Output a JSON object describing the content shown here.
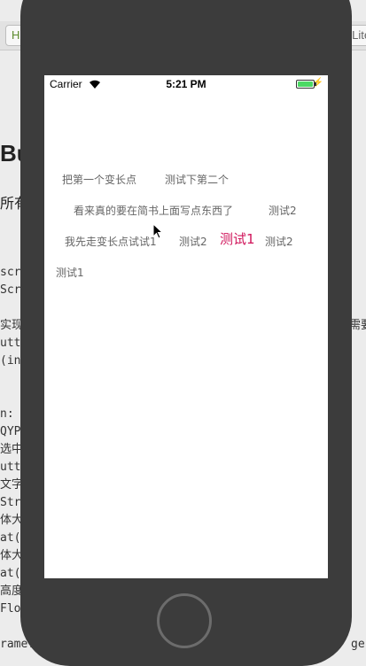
{
  "backdrop": {
    "tab_label": "H",
    "top_right_text": "QLite",
    "heading_big": "Bu",
    "heading_sub": "所有",
    "code_lines": [
      "screen",
      "Scre",
      "",
      "实现类",
      "utto",
      "(in",
      "",
      "",
      "n: (",
      "QYP",
      "选中",
      "utt",
      "文字数",
      "Str",
      "体大小",
      "at(",
      "体大小",
      "at(",
      "高度",
      "Flo",
      "rame:"
    ],
    "right_fragment": "需要",
    "bottom_right_fragment": "ger:"
  },
  "status_bar": {
    "carrier": "Carrier",
    "time": "5:21 PM",
    "battery_level": 1.0,
    "battery_color": "#4cd964"
  },
  "tags": [
    {
      "label": "把第一个变长点",
      "selected": false
    },
    {
      "label": "测试下第二个",
      "selected": false
    },
    {
      "label": "看来真的要在简书上面写点东西了",
      "selected": false
    },
    {
      "label": "测试2",
      "selected": false
    },
    {
      "label": "我先走变长点试试1",
      "selected": false
    },
    {
      "label": "测试2",
      "selected": false
    },
    {
      "label": "测试1",
      "selected": true
    },
    {
      "label": "测试2",
      "selected": false
    },
    {
      "label": "测试1",
      "selected": false
    }
  ],
  "colors": {
    "selected_tag": "#d0145a",
    "tag_text": "#666666",
    "phone_body": "#3c3c3c"
  }
}
